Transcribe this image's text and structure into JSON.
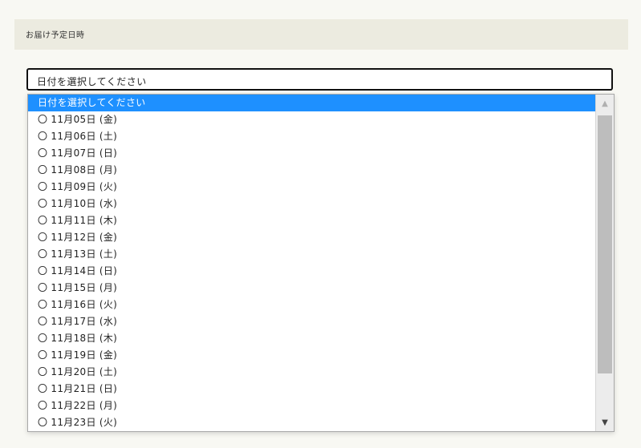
{
  "section": {
    "title": "お届け予定日時"
  },
  "select": {
    "value": "日付を選択してください"
  },
  "dropdown": {
    "options": [
      "日付を選択してください",
      "〇 11月05日 (金)",
      "〇 11月06日 (土)",
      "〇 11月07日 (日)",
      "〇 11月08日 (月)",
      "〇 11月09日 (火)",
      "〇 11月10日 (水)",
      "〇 11月11日 (木)",
      "〇 11月12日 (金)",
      "〇 11月13日 (土)",
      "〇 11月14日 (日)",
      "〇 11月15日 (月)",
      "〇 11月16日 (火)",
      "〇 11月17日 (水)",
      "〇 11月18日 (木)",
      "〇 11月19日 (金)",
      "〇 11月20日 (土)",
      "〇 11月21日 (日)",
      "〇 11月22日 (月)",
      "〇 11月23日 (火)"
    ],
    "selected_index": 0
  },
  "scrollbar": {
    "up_icon": "triangle-up-icon",
    "down_icon": "triangle-down-icon"
  },
  "colors": {
    "page_background": "#f8f8f3",
    "header_background": "#ecebe0",
    "selected_option": "#1e90ff"
  }
}
